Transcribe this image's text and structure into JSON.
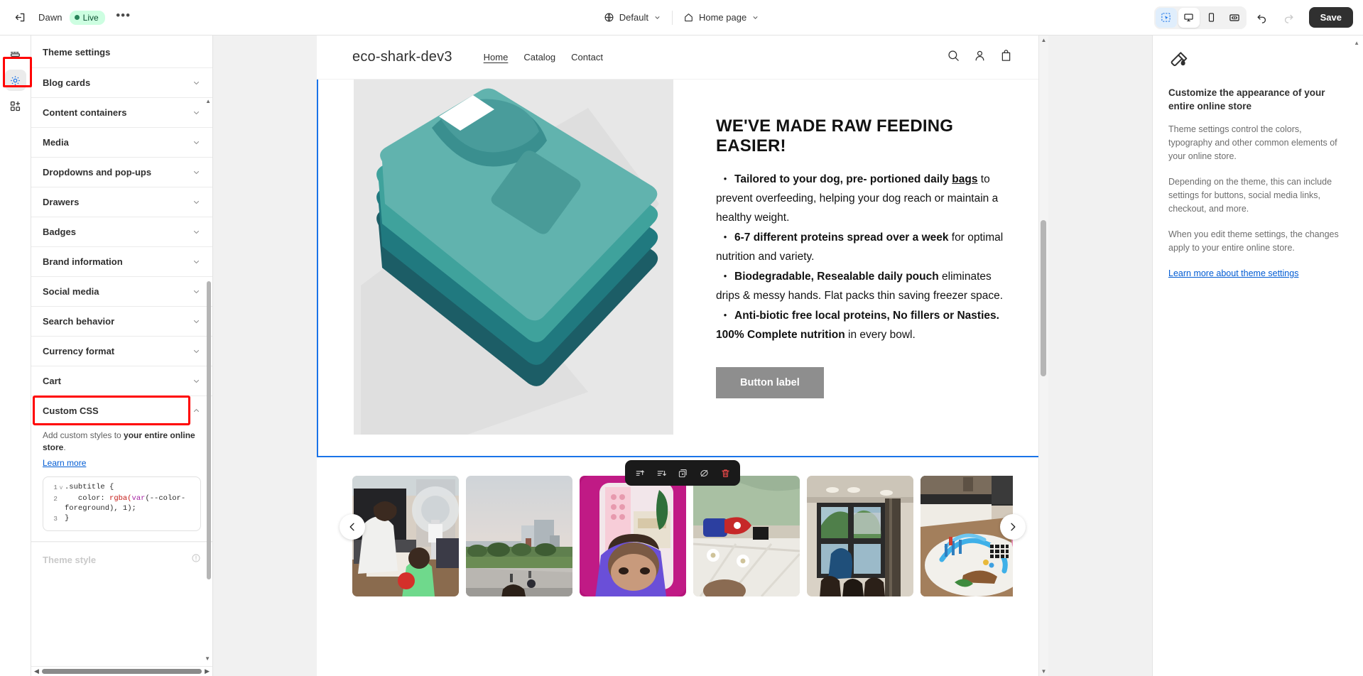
{
  "topbar": {
    "exit_icon": "exit-icon",
    "theme_name": "Dawn",
    "status_badge": "Live",
    "more_label": "•••",
    "locale_selector": {
      "icon": "globe-icon",
      "label": "Default"
    },
    "page_selector": {
      "icon": "home-icon",
      "label": "Home page"
    },
    "view_buttons": [
      {
        "name": "select-mode",
        "icon": "cursor-select-icon"
      },
      {
        "name": "desktop-view",
        "icon": "desktop-icon"
      },
      {
        "name": "mobile-view",
        "icon": "mobile-icon"
      },
      {
        "name": "fullscreen-view",
        "icon": "fullwidth-icon"
      }
    ],
    "undo_icon": "undo-icon",
    "redo_icon": "redo-icon",
    "save_label": "Save"
  },
  "rail": {
    "items": [
      {
        "name": "sections-icon",
        "label": "Sections"
      },
      {
        "name": "theme-settings-icon",
        "label": "Theme settings",
        "active": true
      },
      {
        "name": "apps-icon",
        "label": "Apps"
      }
    ]
  },
  "panel": {
    "title": "Theme settings",
    "groups": [
      {
        "label": "Blog cards",
        "open": false
      },
      {
        "label": "Content containers",
        "open": false
      },
      {
        "label": "Media",
        "open": false
      },
      {
        "label": "Dropdowns and pop-ups",
        "open": false
      },
      {
        "label": "Drawers",
        "open": false
      },
      {
        "label": "Badges",
        "open": false
      },
      {
        "label": "Brand information",
        "open": false
      },
      {
        "label": "Social media",
        "open": false
      },
      {
        "label": "Search behavior",
        "open": false
      },
      {
        "label": "Currency format",
        "open": false
      },
      {
        "label": "Cart",
        "open": false
      }
    ],
    "custom_css": {
      "label": "Custom CSS",
      "help_prefix": "Add custom styles to ",
      "help_bold": "your entire online store",
      "help_suffix": ".",
      "learn_more": "Learn more",
      "code_lines": [
        {
          "number": "1",
          "fold": "v",
          "text": ".subtitle {"
        },
        {
          "number": "2",
          "fold": "",
          "text": "    color: rgba(var(--color-foreground), 1);"
        },
        {
          "number": "3",
          "fold": "",
          "text": "}"
        }
      ]
    },
    "theme_style": {
      "label": "Theme style",
      "icon": "info-icon"
    }
  },
  "preview": {
    "store": {
      "logo": "eco-shark-dev3",
      "nav": [
        {
          "label": "Home",
          "current": true
        },
        {
          "label": "Catalog",
          "current": false
        },
        {
          "label": "Contact",
          "current": false
        }
      ],
      "actions": [
        {
          "name": "search-icon"
        },
        {
          "name": "account-icon"
        },
        {
          "name": "cart-icon"
        }
      ]
    },
    "hero": {
      "image_alt": "folded-tshirt-placeholder",
      "title": "WE'VE MADE RAW FEEDING EASIER!",
      "bullets": [
        {
          "bold_lead": "Tailored to your dog, pre- portioned daily ",
          "underline": "bags",
          "rest": " to prevent overfeeding, helping your dog reach or maintain a healthy weight."
        },
        {
          "bold_lead": "6-7 different proteins spread over a week",
          "underline": "",
          "rest": " for optimal nutrition and variety."
        },
        {
          "bold_lead": "Biodegradable, Resealable daily pouch",
          "underline": "",
          "rest": " eliminates drips & messy hands. Flat packs thin saving freezer space."
        },
        {
          "bold_lead": "Anti-biotic free local proteins, No fillers or Nasties. 100% Complete nutrition",
          "underline": "",
          "rest": " in every bowl."
        }
      ],
      "button_label": "Button label"
    },
    "section_toolbar": [
      {
        "name": "move-up-icon"
      },
      {
        "name": "move-down-icon"
      },
      {
        "name": "duplicate-icon"
      },
      {
        "name": "hide-icon"
      },
      {
        "name": "delete-icon",
        "color": "#ff4d4d"
      }
    ],
    "gallery": {
      "prev_arrow": "chevron-left-icon",
      "next_arrow": "chevron-right-icon",
      "thumbs": [
        {
          "name": "thumb-boy-at-tv"
        },
        {
          "name": "thumb-park-plaza"
        },
        {
          "name": "thumb-pink-room-child"
        },
        {
          "name": "thumb-bed-spiderman-toy"
        },
        {
          "name": "thumb-window-living-room"
        },
        {
          "name": "thumb-toy-track-table"
        }
      ]
    }
  },
  "right_panel": {
    "icon": "paint-roller-icon",
    "title": "Customize the appearance of your entire online store",
    "paragraphs": [
      "Theme settings control the colors, typography and other common elements of your online store.",
      "Depending on the theme, this can include settings for buttons, social media links, checkout, and more.",
      "When you edit theme settings, the changes apply to your entire online store."
    ],
    "link": "Learn more about theme settings"
  },
  "colors": {
    "accent_blue": "#005bd3",
    "highlight_red": "#ff0000",
    "live_green_bg": "#cdfee1",
    "live_green_text": "#0c5132",
    "save_dark": "#303030",
    "selection_border": "#1a73e8",
    "teal_product": "#4aa8a3"
  }
}
